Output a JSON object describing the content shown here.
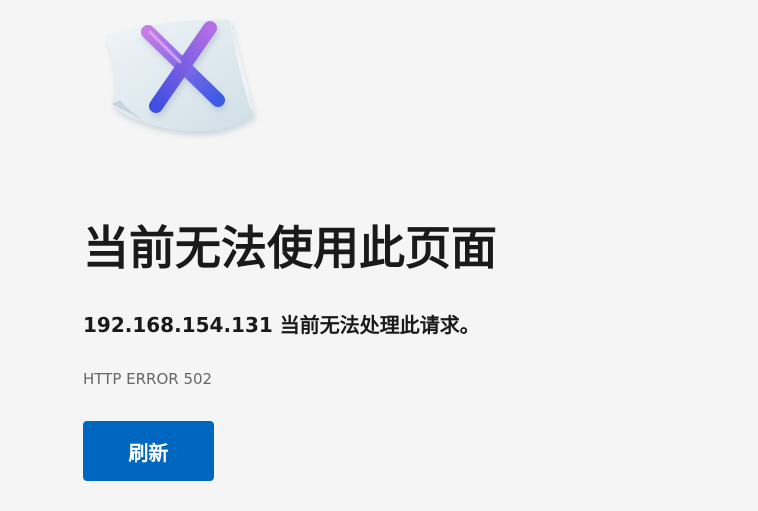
{
  "error_page": {
    "illustration_icon": "paper-x-icon",
    "title": "当前无法使用此页面",
    "description": "192.168.154.131 当前无法处理此请求。",
    "error_code": "HTTP ERROR 502",
    "refresh_label": "刷新"
  },
  "colors": {
    "background": "#f5f5f5",
    "button": "#0067c0",
    "x_gradient_start": "#c77be8",
    "x_gradient_end": "#3c5be6"
  }
}
